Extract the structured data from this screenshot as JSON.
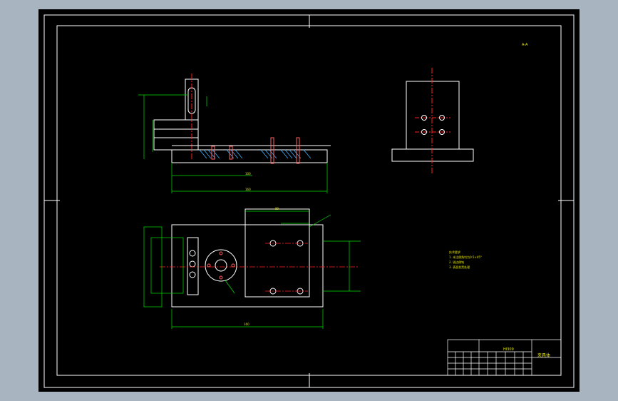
{
  "drawing": {
    "view_label": "A-A",
    "title_block": {
      "code": "HI309",
      "name": "夹具体"
    },
    "tech_notes": [
      "技术要求",
      "1. 未注倒角均为0.5×45°",
      "2. 锐边倒钝",
      "3. 表面发黑处理"
    ]
  },
  "colors": {
    "background": "#000000",
    "outline": "#ffffff",
    "dimension": "#00e000",
    "centerline": "#ff2020",
    "hatch": "#3ab0ff",
    "label": "#e6e600"
  }
}
